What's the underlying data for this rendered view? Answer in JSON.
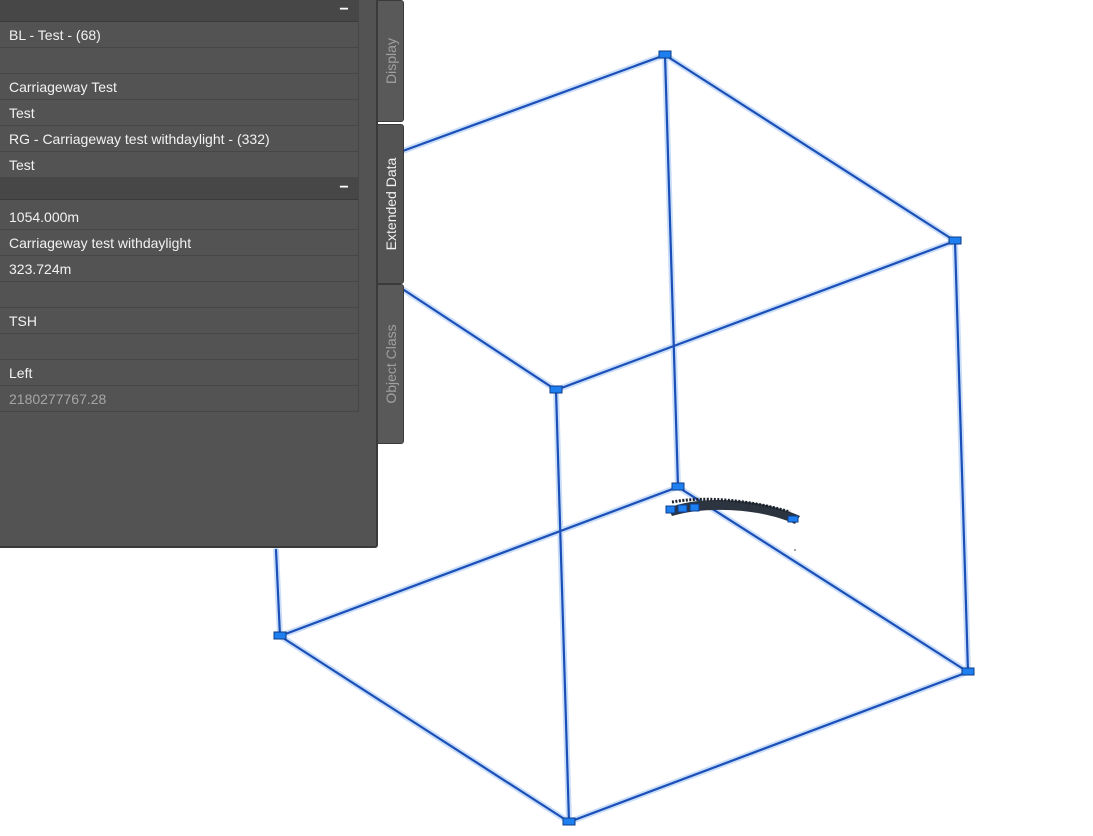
{
  "side_tabs": [
    {
      "label": "Display",
      "active": false
    },
    {
      "label": "Extended Data",
      "active": true
    },
    {
      "label": "Object Class",
      "active": false
    }
  ],
  "sections": [
    {
      "collapse_symbol": "−",
      "rows": [
        "BL - Test - (68)",
        "",
        "Carriageway Test",
        "Test",
        "RG - Carriageway test withdaylight - (332)",
        "Test"
      ]
    },
    {
      "collapse_symbol": "−",
      "rows": [
        "1054.000m",
        "Carriageway test withdaylight",
        "323.724m",
        "",
        "TSH",
        "",
        "Left",
        "2180277767.28"
      ]
    }
  ],
  "viewport": {
    "wireframe_color": "#1a56c8",
    "grip_color": "#1e7ff0",
    "icons": [
      "bounding-box-wireframe",
      "grip-icon",
      "corridor-model-object"
    ]
  }
}
